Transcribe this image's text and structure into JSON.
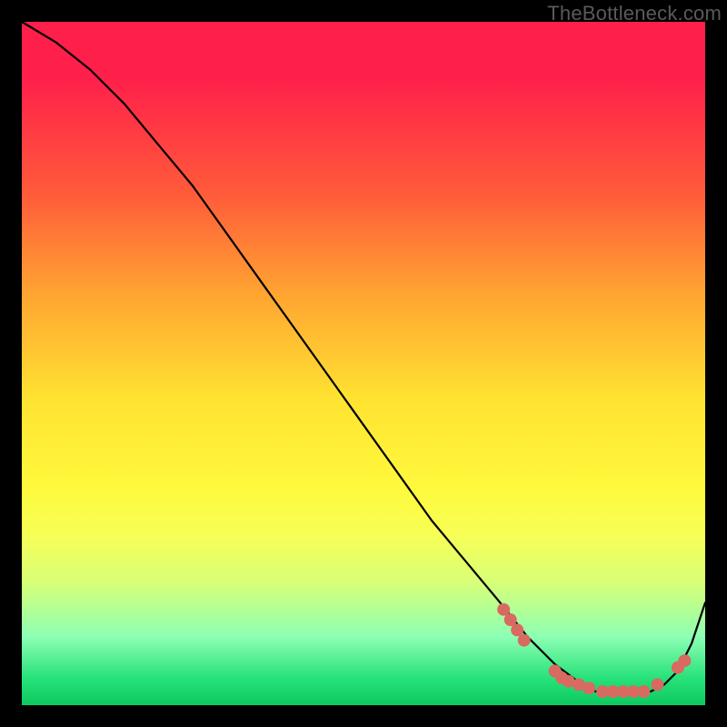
{
  "watermark": "TheBottleneck.com",
  "chart_data": {
    "type": "line",
    "title": "",
    "xlabel": "",
    "ylabel": "",
    "xlim": [
      0,
      100
    ],
    "ylim": [
      0,
      100
    ],
    "grid": false,
    "legend": false,
    "series": [
      {
        "name": "curve",
        "x": [
          0,
          5,
          10,
          15,
          20,
          25,
          30,
          35,
          40,
          45,
          50,
          55,
          60,
          65,
          70,
          74,
          78,
          82,
          84,
          86,
          88,
          90,
          92,
          94,
          96,
          98,
          100
        ],
        "y": [
          100,
          97,
          93,
          88,
          82,
          76,
          69,
          62,
          55,
          48,
          41,
          34,
          27,
          21,
          15,
          10,
          6,
          3,
          2,
          2,
          2,
          2,
          2,
          3,
          5,
          9,
          15
        ]
      }
    ],
    "markers": [
      {
        "x": 70.5,
        "y": 14.0
      },
      {
        "x": 71.5,
        "y": 12.5
      },
      {
        "x": 72.5,
        "y": 11.0
      },
      {
        "x": 73.5,
        "y": 9.5
      },
      {
        "x": 78.0,
        "y": 5.0
      },
      {
        "x": 79.0,
        "y": 4.0
      },
      {
        "x": 80.0,
        "y": 3.5
      },
      {
        "x": 81.5,
        "y": 3.0
      },
      {
        "x": 83.0,
        "y": 2.5
      },
      {
        "x": 85.0,
        "y": 2.0
      },
      {
        "x": 86.5,
        "y": 2.0
      },
      {
        "x": 88.0,
        "y": 2.0
      },
      {
        "x": 89.5,
        "y": 2.0
      },
      {
        "x": 91.0,
        "y": 2.0
      },
      {
        "x": 93.0,
        "y": 3.0
      },
      {
        "x": 96.0,
        "y": 5.5
      },
      {
        "x": 97.0,
        "y": 6.5
      }
    ],
    "marker_color": "#d86a62",
    "marker_radius": 7
  }
}
